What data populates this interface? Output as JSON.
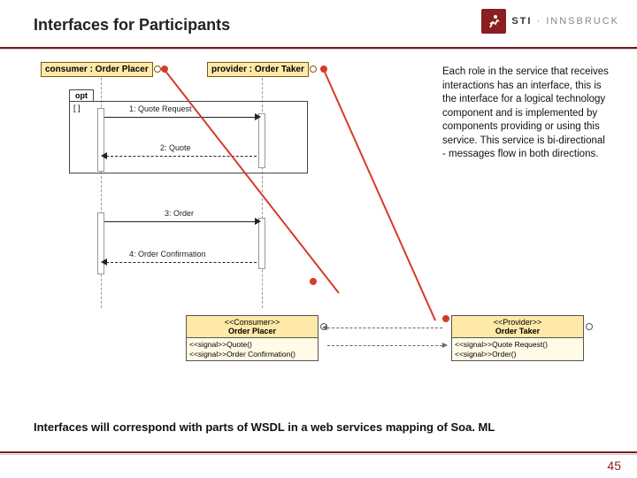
{
  "title": "Interfaces for Participants",
  "logo": {
    "brand_bold": "STI",
    "brand_light": " · INNSBRUCK"
  },
  "sequence": {
    "lifelines": {
      "consumer": "consumer : Order Placer",
      "provider": "provider : Order Taker"
    },
    "opt": {
      "label": "opt",
      "guard": "[ ]"
    },
    "messages": {
      "m1": "1: Quote Request",
      "m2": "2: Quote",
      "m3": "3: Order",
      "m4": "4: Order Confirmation"
    }
  },
  "desc": "Each role in the service that receives interactions has an interface, this is the interface for a logical technology component and is implemented by components providing or using this service. This service is bi-directional - messages flow in both directions.",
  "interfaces": {
    "consumer": {
      "stereo": "<<Consumer>>",
      "name": "Order Placer",
      "ops": [
        "<<signal>>Quote()",
        "<<signal>>Order Confirmation()"
      ]
    },
    "provider": {
      "stereo": "<<Provider>>",
      "name": "Order Taker",
      "ops": [
        "<<signal>>Quote Request()",
        "<<signal>>Order()"
      ]
    }
  },
  "footer": "Interfaces will correspond with parts of WSDL in a web services mapping of Soa. ML",
  "page": "45",
  "url": ""
}
